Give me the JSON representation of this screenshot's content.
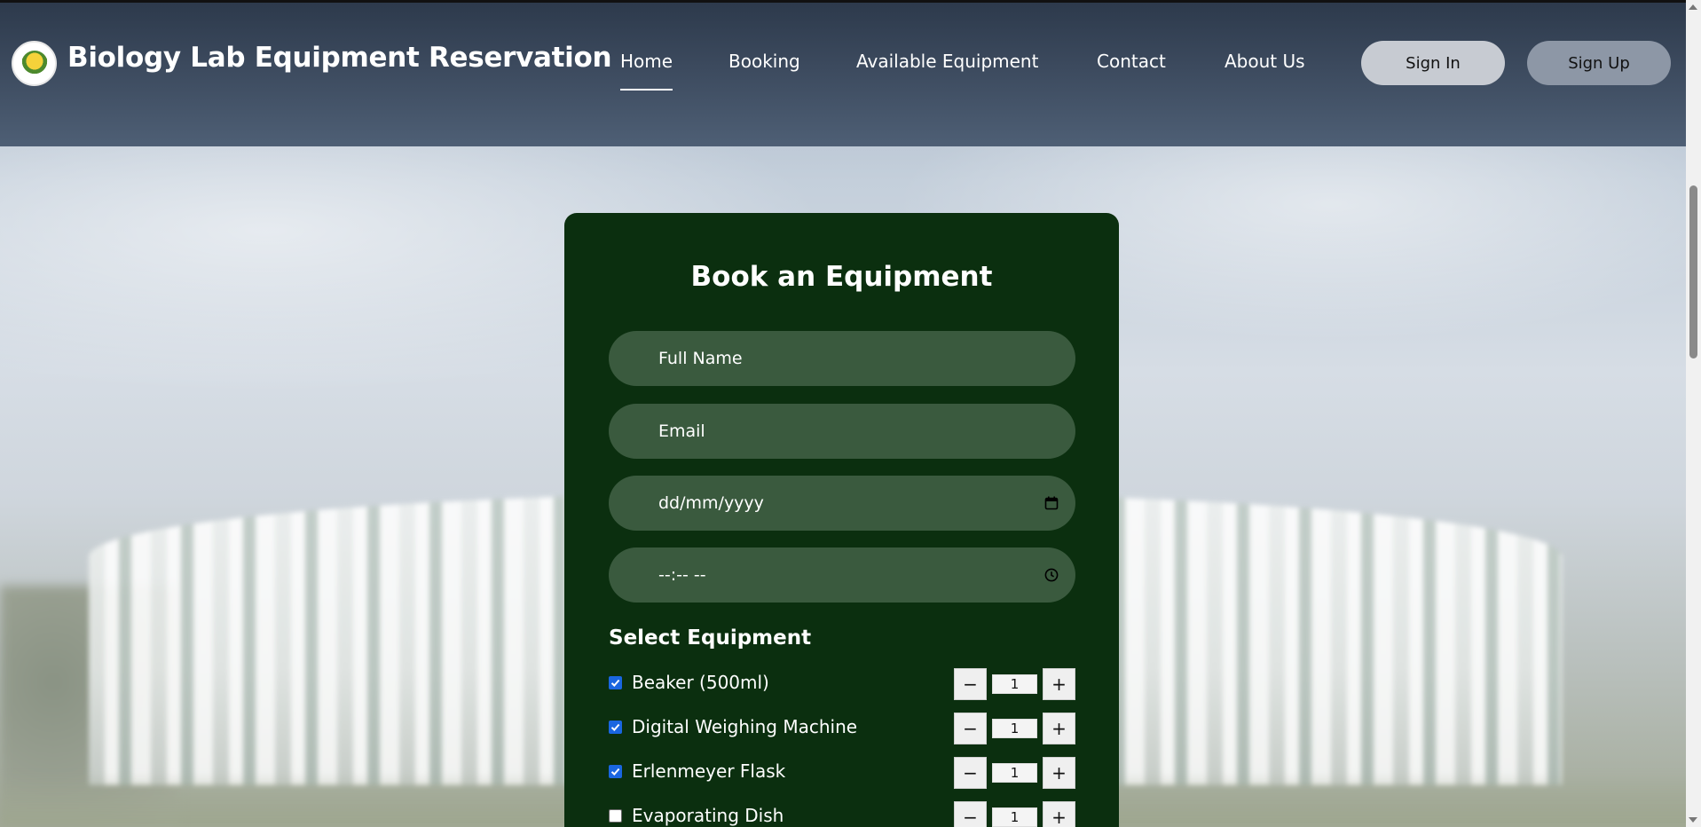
{
  "header": {
    "brand": "Biology Lab Equipment Reservation",
    "nav": [
      {
        "label": "Home",
        "active": true
      },
      {
        "label": "Booking",
        "active": false
      },
      {
        "label": "Available Equipment",
        "active": false
      },
      {
        "label": "Contact",
        "active": false
      },
      {
        "label": "About Us",
        "active": false
      }
    ],
    "sign_in": "Sign In",
    "sign_up": "Sign Up"
  },
  "form": {
    "title": "Book an Equipment",
    "full_name_placeholder": "Full Name",
    "email_placeholder": "Email",
    "date_placeholder": "dd/mm/yyyy",
    "time_placeholder": "--:-- --",
    "section_title": "Select Equipment",
    "equipment": [
      {
        "name": "Beaker (500ml)",
        "checked": true,
        "qty": "1"
      },
      {
        "name": "Digital Weighing Machine",
        "checked": true,
        "qty": "1"
      },
      {
        "name": "Erlenmeyer Flask",
        "checked": true,
        "qty": "1"
      },
      {
        "name": "Evaporating Dish",
        "checked": false,
        "qty": "1"
      }
    ],
    "minus": "−",
    "plus": "+"
  },
  "colors": {
    "card": "#0b2f0f",
    "field": "#3a5a3e",
    "checkbox_on": "#1a66e0"
  }
}
